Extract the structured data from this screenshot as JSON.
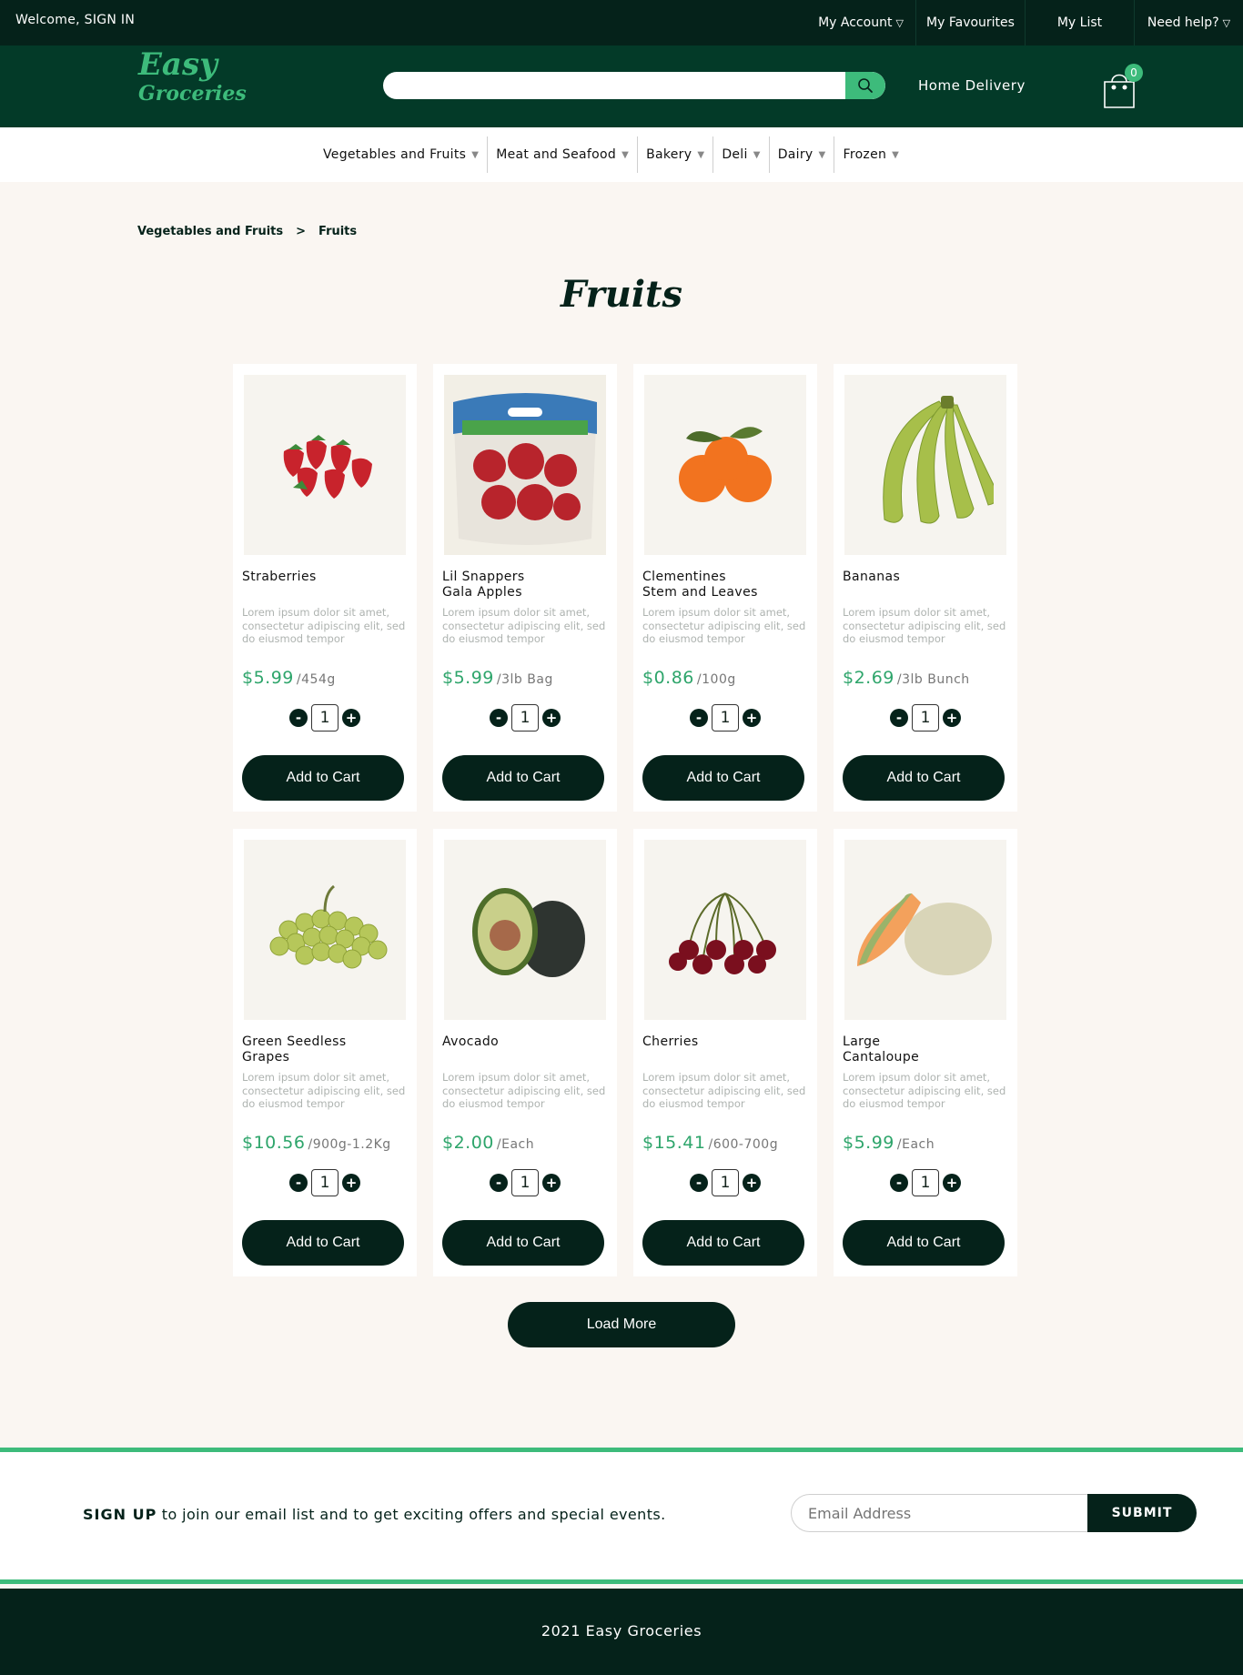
{
  "topbar": {
    "welcome": "Welcome, SIGN IN",
    "links": [
      {
        "label": "My Account",
        "arrow": "▽"
      },
      {
        "label": "My Favourites"
      },
      {
        "label": "My List"
      },
      {
        "label": "Need help?",
        "arrow": "▽"
      }
    ]
  },
  "header": {
    "logo_line1": "Easy",
    "logo_line2": "Groceries",
    "search_placeholder": "",
    "home_delivery": "Home Delivery",
    "cart_count": "0"
  },
  "categories": [
    "Vegetables and Fruits",
    "Meat and Seafood",
    "Bakery",
    "Deli",
    "Dairy",
    "Frozen"
  ],
  "breadcrumb": {
    "parent": "Vegetables and Fruits",
    "separator": ">",
    "current": "Fruits"
  },
  "page_title": "Fruits",
  "products": [
    {
      "name1": "Straberries",
      "name2": "",
      "desc": "Lorem ipsum dolor sit amet, consectetur adipiscing elit, sed do eiusmod tempor",
      "price": "$5.99",
      "unit": "/454g",
      "qty": "1",
      "button": "Add to Cart",
      "icon": "strawberries-image"
    },
    {
      "name1": "Lil Snappers",
      "name2": "Gala Apples",
      "desc": "Lorem ipsum dolor sit amet, consectetur adipiscing elit, sed do eiusmod tempor",
      "price": "$5.99",
      "unit": "/3lb Bag",
      "qty": "1",
      "button": "Add to Cart",
      "icon": "apples-bag-image"
    },
    {
      "name1": "Clementines",
      "name2": "Stem and Leaves",
      "desc": "Lorem ipsum dolor sit amet, consectetur adipiscing elit, sed do eiusmod tempor",
      "price": "$0.86",
      "unit": "/100g",
      "qty": "1",
      "button": "Add to Cart",
      "icon": "clementines-image"
    },
    {
      "name1": "Bananas",
      "name2": "",
      "desc": "Lorem ipsum dolor sit amet, consectetur adipiscing elit, sed do eiusmod tempor",
      "price": "$2.69",
      "unit": "/3lb Bunch",
      "qty": "1",
      "button": "Add to Cart",
      "icon": "bananas-image"
    },
    {
      "name1": "Green Seedless",
      "name2": "Grapes",
      "desc": "Lorem ipsum dolor sit amet, consectetur adipiscing elit, sed do eiusmod tempor",
      "price": "$10.56",
      "unit": "/900g-1.2Kg",
      "qty": "1",
      "button": "Add to Cart",
      "icon": "grapes-image"
    },
    {
      "name1": "Avocado",
      "name2": "",
      "desc": "Lorem ipsum dolor sit amet, consectetur adipiscing elit, sed do eiusmod tempor",
      "price": "$2.00",
      "unit": "/Each",
      "qty": "1",
      "button": "Add to Cart",
      "icon": "avocado-image"
    },
    {
      "name1": "Cherries",
      "name2": "",
      "desc": "Lorem ipsum dolor sit amet, consectetur adipiscing elit, sed do eiusmod tempor",
      "price": "$15.41",
      "unit": "/600-700g",
      "qty": "1",
      "button": "Add to Cart",
      "icon": "cherries-image"
    },
    {
      "name1": "Large",
      "name2": "Cantaloupe",
      "desc": "Lorem ipsum dolor sit amet, consectetur adipiscing elit, sed do eiusmod tempor",
      "price": "$5.99",
      "unit": "/Each",
      "qty": "1",
      "button": "Add to Cart",
      "icon": "cantaloupe-image"
    }
  ],
  "qty_minus": "-",
  "qty_plus": "+",
  "load_more": "Load More",
  "newsletter": {
    "bold": "SIGN UP",
    "text": " to join our email list and to get exciting offers and special events.",
    "email_placeholder": "Email Address",
    "submit": "SUBMIT"
  },
  "footer": {
    "copyright": "2021 Easy Groceries"
  },
  "colors": {
    "dark": "#05221a",
    "header_green": "#033a28",
    "accent": "#3dbb7b",
    "price": "#2ea56b",
    "background": "#faf6f2"
  }
}
